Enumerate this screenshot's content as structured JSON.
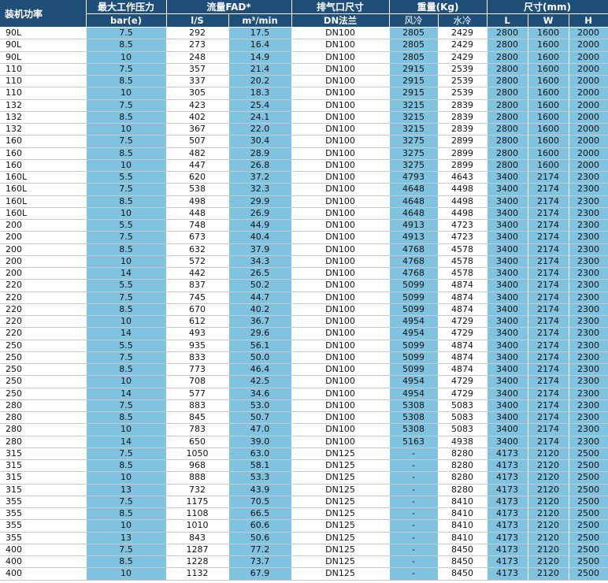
{
  "header": {
    "power": "装机功率",
    "pressure": "最大工作压力",
    "pressure_unit": "bar(e)",
    "flow": "流量FAD*",
    "flow_unit_ls": "l/S",
    "flow_unit_m3": "m³/min",
    "outlet": "排气口尺寸",
    "outlet_unit": "DN法兰",
    "weight": "重量(Kg)",
    "weight_air": "风冷",
    "weight_water": "水冷",
    "dims": "尺寸(mm)",
    "dim_l": "L",
    "dim_w": "W",
    "dim_h": "H"
  },
  "rows": [
    [
      "90L",
      "7.5",
      "292",
      "17.5",
      "DN100",
      "2805",
      "2429",
      "2800",
      "1600",
      "2000"
    ],
    [
      "90L",
      "8.5",
      "273",
      "16.4",
      "DN100",
      "2805",
      "2429",
      "2800",
      "1600",
      "2000"
    ],
    [
      "90L",
      "10",
      "248",
      "14.9",
      "DN100",
      "2805",
      "2429",
      "2800",
      "1600",
      "2000"
    ],
    [
      "110",
      "7.5",
      "357",
      "21.4",
      "DN100",
      "2915",
      "2539",
      "2800",
      "1600",
      "2000"
    ],
    [
      "110",
      "8.5",
      "337",
      "20.2",
      "DN100",
      "2915",
      "2539",
      "2800",
      "1600",
      "2000"
    ],
    [
      "110",
      "10",
      "305",
      "18.3",
      "DN100",
      "2915",
      "2539",
      "2800",
      "1600",
      "2000"
    ],
    [
      "132",
      "7.5",
      "423",
      "25.4",
      "DN100",
      "3215",
      "2839",
      "2800",
      "1600",
      "2000"
    ],
    [
      "132",
      "8.5",
      "402",
      "24.1",
      "DN100",
      "3215",
      "2839",
      "2800",
      "1600",
      "2000"
    ],
    [
      "132",
      "10",
      "367",
      "22.0",
      "DN100",
      "3215",
      "2839",
      "2800",
      "1600",
      "2000"
    ],
    [
      "160",
      "7.5",
      "507",
      "30.4",
      "DN100",
      "3275",
      "2899",
      "2800",
      "1600",
      "2000"
    ],
    [
      "160",
      "8.5",
      "482",
      "28.9",
      "DN100",
      "3275",
      "2899",
      "2800",
      "1600",
      "2000"
    ],
    [
      "160",
      "10",
      "447",
      "26.8",
      "DN100",
      "3275",
      "2899",
      "2800",
      "1600",
      "2000"
    ],
    [
      "160L",
      "5.5",
      "620",
      "37.2",
      "DN100",
      "4793",
      "4643",
      "3400",
      "2174",
      "2300"
    ],
    [
      "160L",
      "7.5",
      "538",
      "32.3",
      "DN100",
      "4648",
      "4498",
      "3400",
      "2174",
      "2300"
    ],
    [
      "160L",
      "8.5",
      "498",
      "29.9",
      "DN100",
      "4648",
      "4498",
      "3400",
      "2174",
      "2300"
    ],
    [
      "160L",
      "10",
      "448",
      "26.9",
      "DN100",
      "4648",
      "4498",
      "3400",
      "2174",
      "2300"
    ],
    [
      "200",
      "5.5",
      "748",
      "44.9",
      "DN100",
      "4913",
      "4723",
      "3400",
      "2174",
      "2300"
    ],
    [
      "200",
      "7.5",
      "673",
      "40.4",
      "DN100",
      "4913",
      "4723",
      "3400",
      "2174",
      "2300"
    ],
    [
      "200",
      "8.5",
      "632",
      "37.9",
      "DN100",
      "4768",
      "4578",
      "3400",
      "2174",
      "2300"
    ],
    [
      "200",
      "10",
      "572",
      "34.3",
      "DN100",
      "4768",
      "4578",
      "3400",
      "2174",
      "2300"
    ],
    [
      "200",
      "14",
      "442",
      "26.5",
      "DN100",
      "4768",
      "4578",
      "3400",
      "2174",
      "2300"
    ],
    [
      "220",
      "5.5",
      "837",
      "50.2",
      "DN100",
      "5099",
      "4874",
      "3400",
      "2174",
      "2300"
    ],
    [
      "220",
      "7.5",
      "745",
      "44.7",
      "DN100",
      "5099",
      "4874",
      "3400",
      "2174",
      "2300"
    ],
    [
      "220",
      "8.5",
      "670",
      "40.2",
      "DN100",
      "5099",
      "4874",
      "3400",
      "2174",
      "2300"
    ],
    [
      "220",
      "10",
      "612",
      "36.7",
      "DN100",
      "4954",
      "4729",
      "3400",
      "2174",
      "2300"
    ],
    [
      "220",
      "14",
      "493",
      "29.6",
      "DN100",
      "4954",
      "4729",
      "3400",
      "2174",
      "2300"
    ],
    [
      "250",
      "5.5",
      "935",
      "56.1",
      "DN100",
      "5099",
      "4874",
      "3400",
      "2174",
      "2300"
    ],
    [
      "250",
      "7.5",
      "833",
      "50.0",
      "DN100",
      "5099",
      "4874",
      "3400",
      "2174",
      "2300"
    ],
    [
      "250",
      "8.5",
      "773",
      "46.4",
      "DN100",
      "5099",
      "4874",
      "3400",
      "2174",
      "2300"
    ],
    [
      "250",
      "10",
      "708",
      "42.5",
      "DN100",
      "4954",
      "4729",
      "3400",
      "2174",
      "2300"
    ],
    [
      "250",
      "14",
      "577",
      "34.6",
      "DN100",
      "4954",
      "4729",
      "3400",
      "2174",
      "2300"
    ],
    [
      "280",
      "7.5",
      "883",
      "53.0",
      "DN100",
      "5308",
      "5083",
      "3400",
      "2174",
      "2300"
    ],
    [
      "280",
      "8.5",
      "845",
      "50.7",
      "DN100",
      "5308",
      "5083",
      "3400",
      "2174",
      "2300"
    ],
    [
      "280",
      "10",
      "783",
      "47.0",
      "DN100",
      "5308",
      "5083",
      "3400",
      "2174",
      "2300"
    ],
    [
      "280",
      "14",
      "650",
      "39.0",
      "DN100",
      "5163",
      "4938",
      "3400",
      "2174",
      "2300"
    ],
    [
      "315",
      "7.5",
      "1050",
      "63.0",
      "DN125",
      "-",
      "8280",
      "4173",
      "2120",
      "2500"
    ],
    [
      "315",
      "8.5",
      "968",
      "58.1",
      "DN125",
      "-",
      "8280",
      "4173",
      "2120",
      "2500"
    ],
    [
      "315",
      "10",
      "888",
      "53.3",
      "DN125",
      "-",
      "8280",
      "4173",
      "2120",
      "2500"
    ],
    [
      "315",
      "13",
      "732",
      "43.9",
      "DN125",
      "-",
      "8280",
      "4173",
      "2120",
      "2500"
    ],
    [
      "355",
      "7.5",
      "1175",
      "70.5",
      "DN125",
      "-",
      "8410",
      "4173",
      "2120",
      "2500"
    ],
    [
      "355",
      "8.5",
      "1108",
      "66.5",
      "DN125",
      "-",
      "8410",
      "4173",
      "2120",
      "2500"
    ],
    [
      "355",
      "10",
      "1010",
      "60.6",
      "DN125",
      "-",
      "8410",
      "4173",
      "2120",
      "2500"
    ],
    [
      "355",
      "13",
      "843",
      "50.6",
      "DN125",
      "-",
      "8410",
      "4173",
      "2120",
      "2500"
    ],
    [
      "400",
      "7.5",
      "1287",
      "77.2",
      "DN125",
      "-",
      "8450",
      "4173",
      "2120",
      "2500"
    ],
    [
      "400",
      "8.5",
      "1228",
      "73.7",
      "DN125",
      "-",
      "8450",
      "4173",
      "2120",
      "2500"
    ],
    [
      "400",
      "10",
      "1132",
      "67.9",
      "DN125",
      "-",
      "8450",
      "4173",
      "2120",
      "2500"
    ]
  ]
}
